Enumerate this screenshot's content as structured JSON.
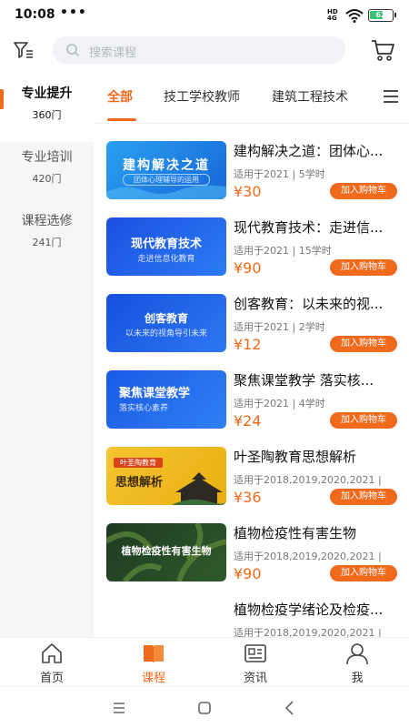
{
  "status_bar": {
    "time": "10:08",
    "dots": "•••",
    "network": "HD",
    "network_sub": "4G",
    "battery": "62",
    "battery_level": 0.62
  },
  "header": {
    "search_placeholder": "搜索课程"
  },
  "sidebar": {
    "items": [
      {
        "label": "专业提升",
        "count": "360门"
      },
      {
        "label": "专业培训",
        "count": "420门"
      },
      {
        "label": "课程选修",
        "count": "241门"
      }
    ]
  },
  "tabs": {
    "items": [
      {
        "label": "全部"
      },
      {
        "label": "技工学校教师"
      },
      {
        "label": "建筑工程技术"
      }
    ]
  },
  "courses": [
    {
      "title": "建构解决之道：团体心...",
      "meta": "适用于2021 | 5学时",
      "price": "¥30",
      "button": "加入购物车",
      "thumb_title": "建构解决之道",
      "thumb_sub": "团体心理辅导的运用"
    },
    {
      "title": "现代教育技术：走进信...",
      "meta": "适用于2021 | 15学时",
      "price": "¥90",
      "button": "加入购物车",
      "thumb_title": "现代教育技术",
      "thumb_sub": "走进信息化教育"
    },
    {
      "title": "创客教育：以未来的视...",
      "meta": "适用于2021 | 2学时",
      "price": "¥12",
      "button": "加入购物车",
      "thumb_title": "创客教育",
      "thumb_sub": "以未来的视角导引未来"
    },
    {
      "title": "聚焦课堂教学 落实核...",
      "meta": "适用于2021 | 4学时",
      "price": "¥24",
      "button": "加入购物车",
      "thumb_title": "聚焦课堂教学",
      "thumb_sub": "落实核心素养"
    },
    {
      "title": "叶圣陶教育思想解析",
      "meta": "适用于2018,2019,2020,2021 |",
      "price": "¥36",
      "button": "加入购物车",
      "thumb_title": "思想解析",
      "thumb_sub": "叶圣陶教育"
    },
    {
      "title": "植物检疫性有害生物",
      "meta": "适用于2018,2019,2020,2021 |",
      "price": "¥90",
      "button": "加入购物车",
      "thumb_title": "植物检疫性有害生物",
      "thumb_sub": ""
    },
    {
      "title": "植物检疫学绪论及检疫...",
      "meta": "适用于2018,2019,2020,2021 |",
      "price": "",
      "button": "",
      "thumb_title": "",
      "thumb_sub": ""
    }
  ],
  "bottom_nav": {
    "items": [
      {
        "label": "首页"
      },
      {
        "label": "课程"
      },
      {
        "label": "资讯"
      },
      {
        "label": "我"
      }
    ]
  },
  "colors": {
    "accent": "#f06a1c",
    "blue": "#1f6ff2",
    "sidebar_bg": "#f5f6f8"
  }
}
